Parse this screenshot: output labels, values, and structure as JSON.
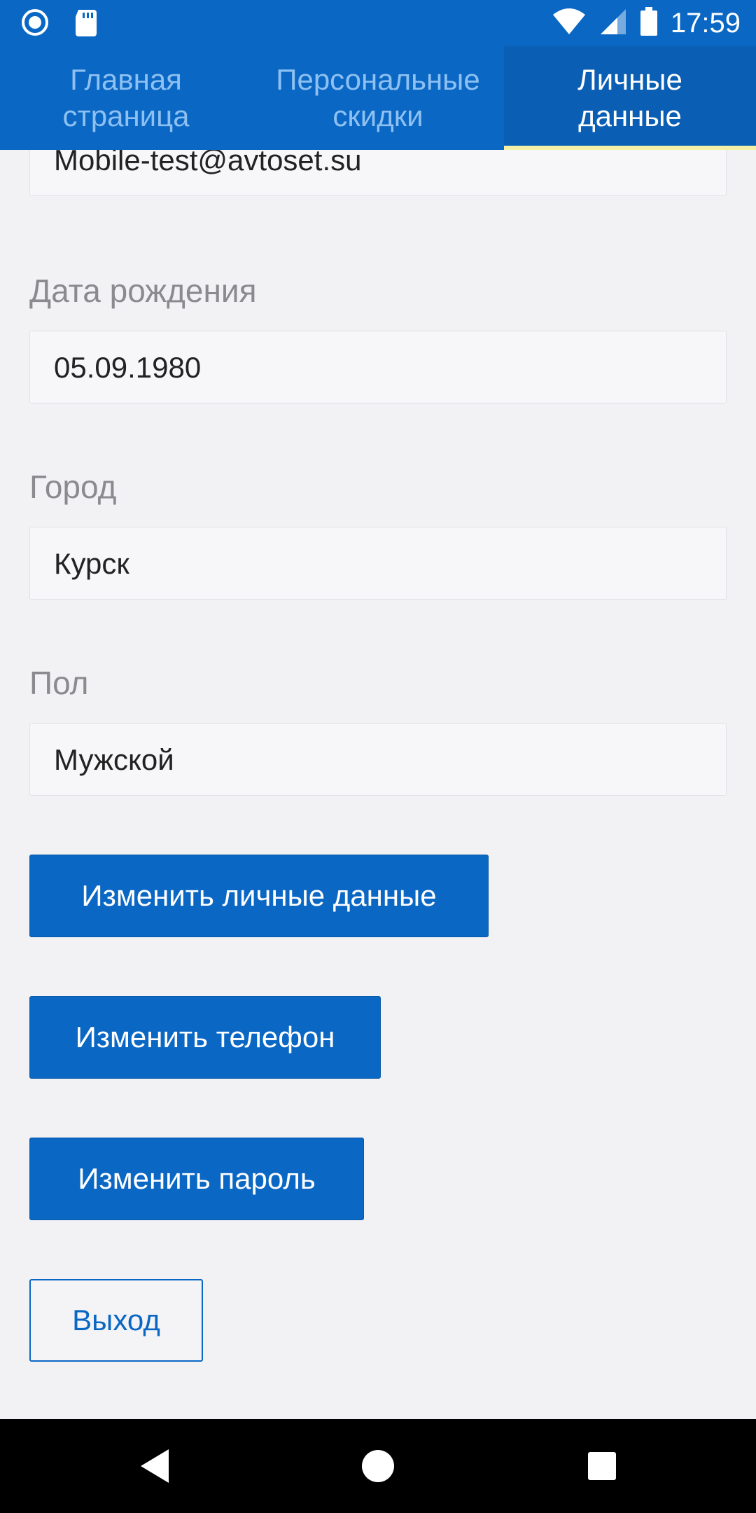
{
  "status_bar": {
    "time": "17:59",
    "icons": [
      "record-icon",
      "sd-card-icon",
      "wifi-icon",
      "signal-icon",
      "battery-icon"
    ]
  },
  "tabs": [
    {
      "label": "Главная\nстраница",
      "active": false
    },
    {
      "label": "Персональные\nскидки",
      "active": false
    },
    {
      "label": "Личные\nданные",
      "active": true
    }
  ],
  "fields": {
    "email": {
      "value": "Mobile-test@avtoset.su"
    },
    "birthdate": {
      "label": "Дата рождения",
      "value": "05.09.1980"
    },
    "city": {
      "label": "Город",
      "value": "Курск"
    },
    "gender": {
      "label": "Пол",
      "value": "Мужской"
    }
  },
  "buttons": {
    "edit_personal": "Изменить личные данные",
    "edit_phone": "Изменить телефон",
    "edit_password": "Изменить пароль",
    "logout": "Выход"
  },
  "colors": {
    "primary": "#0a67c4",
    "tab_indicator": "#f4f0a8"
  },
  "nav": [
    "back-icon",
    "home-icon",
    "recents-icon"
  ]
}
